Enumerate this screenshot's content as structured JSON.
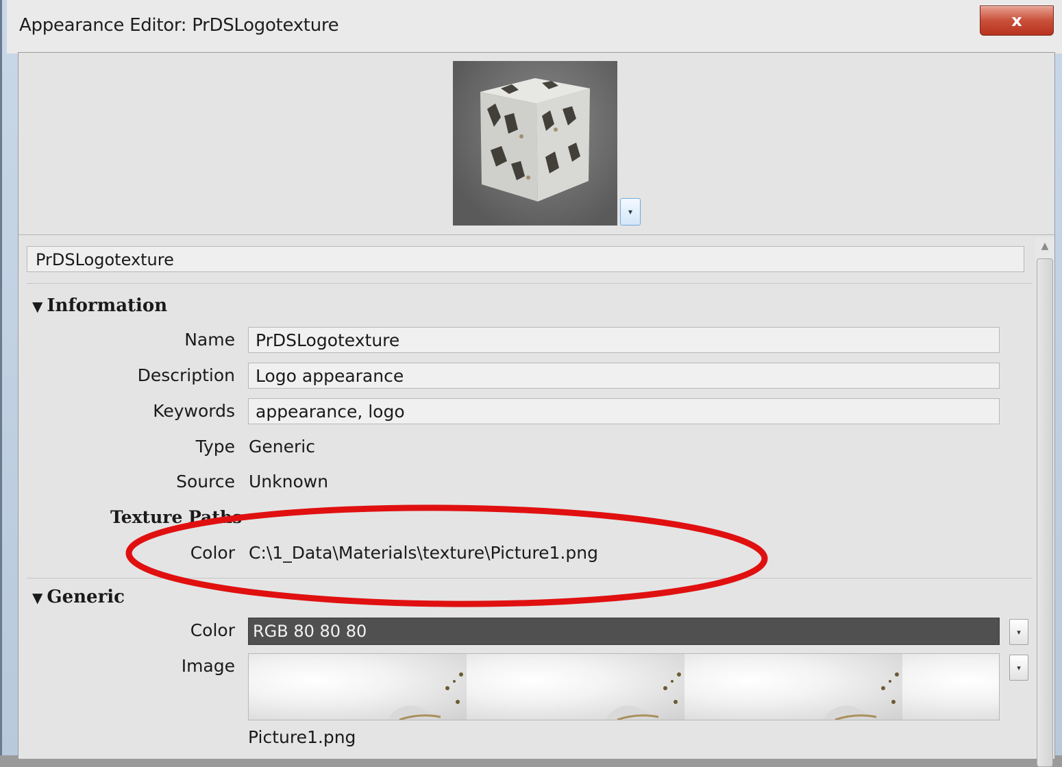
{
  "window": {
    "title": "Appearance Editor: PrDSLogotexture",
    "close_label": "x"
  },
  "appearance_name": "PrDSLogotexture",
  "information": {
    "header": "Information",
    "fields": {
      "name_label": "Name",
      "name_value": "PrDSLogotexture",
      "description_label": "Description",
      "description_value": "Logo appearance",
      "keywords_label": "Keywords",
      "keywords_value": "appearance, logo",
      "type_label": "Type",
      "type_value": "Generic",
      "source_label": "Source",
      "source_value": "Unknown"
    },
    "texture_paths": {
      "header": "Texture Paths",
      "color_label": "Color",
      "color_value": "C:\\1_Data\\Materials\\texture\\Picture1.png"
    }
  },
  "generic": {
    "header": "Generic",
    "color_label": "Color",
    "color_value": "RGB 80 80 80",
    "image_label": "Image",
    "image_filename": "Picture1.png"
  },
  "colors": {
    "annotation_ellipse": "#e01010",
    "generic_color_swatch": "#505050"
  },
  "icons": {
    "collapse_triangle": "▼",
    "dropdown_arrow": "▾",
    "scroll_up": "▲"
  }
}
